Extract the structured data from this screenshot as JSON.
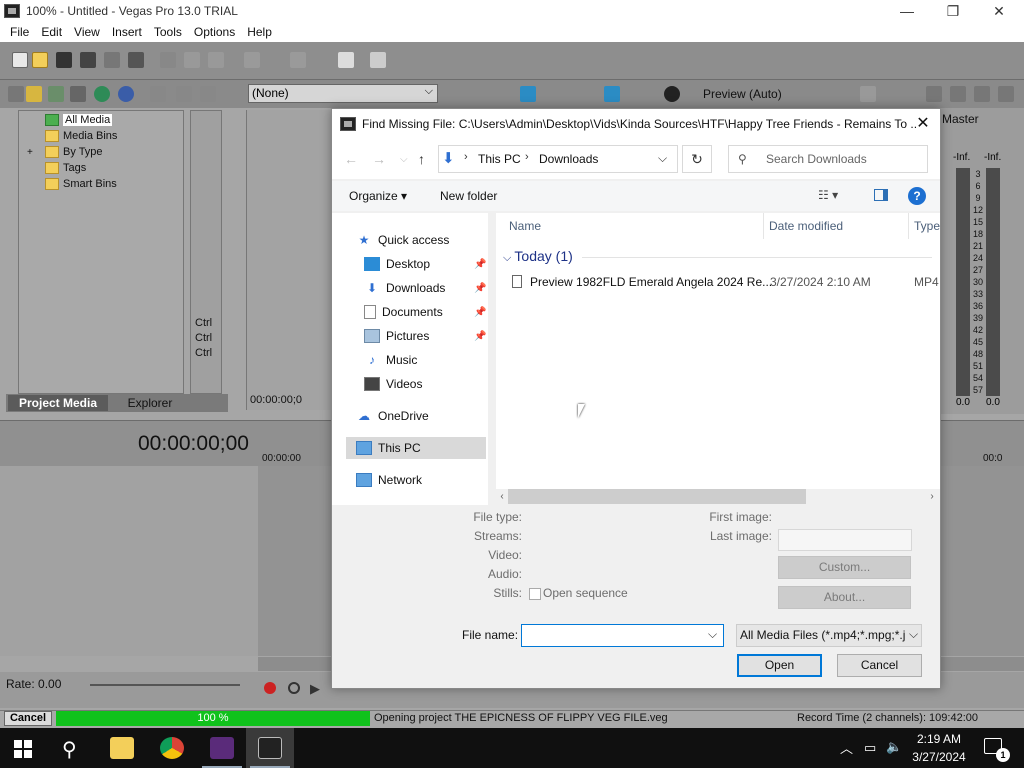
{
  "vegas": {
    "window_title": "100% - Untitled - Vegas Pro 13.0 TRIAL",
    "window_controls": {
      "minimize": "—",
      "maximize": "❐",
      "close": "✕"
    },
    "menu": [
      "File",
      "Edit",
      "View",
      "Insert",
      "Tools",
      "Options",
      "Help"
    ],
    "none_select": "(None)",
    "preview_quality": "Preview (Auto)",
    "media_tree": {
      "items": [
        {
          "label": "All Media"
        },
        {
          "label": "Media Bins"
        },
        {
          "label": "By Type",
          "expander": "+"
        },
        {
          "label": "Tags"
        },
        {
          "label": "Smart Bins"
        }
      ]
    },
    "ctrl_list": [
      "Ctrl",
      "Ctrl",
      "Ctrl"
    ],
    "panel_tabs": {
      "project_media": "Project Media",
      "explorer": "Explorer"
    },
    "trimmer_timecode": "00:00:00;0",
    "mixer": {
      "title": "Master",
      "scale": [
        "3",
        "6",
        "9",
        "12",
        "15",
        "18",
        "21",
        "24",
        "27",
        "30",
        "33",
        "36",
        "39",
        "42",
        "45",
        "48",
        "51",
        "54",
        "57"
      ],
      "inf_l": "-Inf.",
      "inf_r": "-Inf.",
      "value_l": "0.0",
      "value_r": "0.0"
    },
    "timeline": {
      "main_timecode": "00:00:00;00",
      "ruler_start": "00:00:00",
      "ruler_end": "00:0"
    },
    "rate": "Rate: 0.00",
    "status": {
      "cancel_label": "Cancel",
      "progress_text": "100 %",
      "progress": 1.0,
      "message": "Opening project THE EPICNESS OF FLIPPY VEG FILE.veg",
      "record_time": "Record Time (2 channels): 109:42:00"
    }
  },
  "dialog": {
    "title": "Find Missing File: C:\\Users\\Admin\\Desktop\\Vids\\Kinda Sources\\HTF\\Happy Tree Friends - Remains To ...",
    "close_glyph": "✕",
    "address": {
      "this_pc": "This PC",
      "downloads": "Downloads",
      "sep": "›",
      "drop": "⌵"
    },
    "search_placeholder": "Search Downloads",
    "organize": "Organize ▾",
    "new_folder": "New folder",
    "help_glyph": "?",
    "nav": {
      "quick_access": "Quick access",
      "desktop": "Desktop",
      "downloads": "Downloads",
      "documents": "Documents",
      "pictures": "Pictures",
      "music": "Music",
      "videos": "Videos",
      "onedrive": "OneDrive",
      "this_pc": "This PC",
      "network": "Network"
    },
    "columns": {
      "name": "Name",
      "date": "Date modified",
      "type": "Type"
    },
    "group": "Today (1)",
    "files": [
      {
        "name": "Preview 1982FLD Emerald Angela 2024 Re...",
        "date": "3/27/2024 2:10 AM",
        "type": "MP4"
      }
    ],
    "info": {
      "file_type": "File type:",
      "streams": "Streams:",
      "video": "Video:",
      "audio": "Audio:",
      "stills": "Stills:",
      "first_image": "First image:",
      "last_image": "Last image:",
      "open_sequence": "Open sequence",
      "custom_btn": "Custom...",
      "about_btn": "About..."
    },
    "file_name_label": "File name:",
    "file_name_value": "",
    "filter": "All Media Files (*.mp4;*.mpg;*.j",
    "open_btn": "Open",
    "cancel_btn": "Cancel"
  },
  "taskbar": {
    "clock_time": "2:19 AM",
    "clock_date": "3/27/2024",
    "notification_count": "1"
  }
}
